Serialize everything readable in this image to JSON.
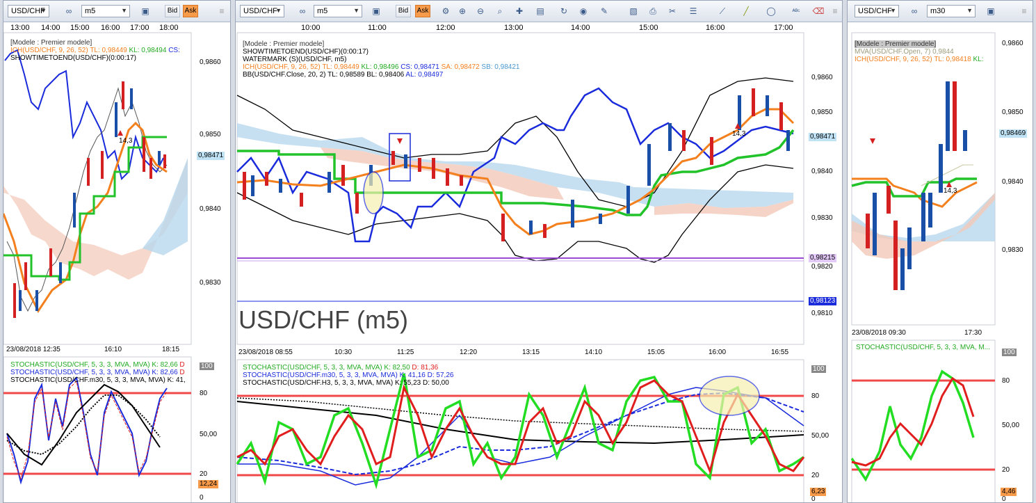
{
  "windows": {
    "left": {
      "symbol": "USD/CHF",
      "timeframe": "m5",
      "bid": "Bid",
      "ask": "Ask",
      "time_labels": [
        "13:00",
        "14:00",
        "15:00",
        "16:00",
        "17:00",
        "18:00"
      ],
      "price_labels": [
        "0,9860",
        "0,9850",
        "0,9840",
        "0,9830"
      ],
      "price_tag": "0,98471",
      "legend": {
        "model": "[Modele : Premier modele]",
        "ich": "ICH(USD/CHF, 9, 26, 52)",
        "ich_tl": "TL: 0,98449",
        "ich_kl": "KL: 0,98494",
        "ich_cs": "CS:",
        "showtime": "SHOWTIMETOEND(USD/CHF)(0:00:17)"
      },
      "date_labels": [
        "23/08/2018 12:35",
        "16:10",
        "18:15"
      ],
      "arrow_label": "14,3",
      "stoch": {
        "l1": "STOCHASTIC(USD/CHF, 5, 3, 3, MVA, MVA)",
        "l1k": "K: 82,66",
        "l1d": "D",
        "l2": "STOCHASTIC(USD/CHF, 5, 3, 3, MVA, MVA)",
        "l2k": "K: 82,66",
        "l2d": "D",
        "l3": "STOCHASTIC(USD/CHF.m30, 5, 3, 3, MVA, MVA)",
        "l3k": "K: 41,",
        "levels": [
          "100",
          "80",
          "50,00",
          "20",
          "0"
        ],
        "tag": "12,24"
      }
    },
    "center": {
      "symbol": "USD/CHF",
      "timeframe": "m5",
      "bid": "Bid",
      "ask": "Ask",
      "time_labels": [
        "10:00",
        "11:00",
        "12:00",
        "13:00",
        "14:00",
        "15:00",
        "16:00",
        "17:00"
      ],
      "price_labels": [
        "0,9860",
        "0,9850",
        "0,9840",
        "0,9830",
        "0,9820",
        "0,9810"
      ],
      "price_tag": "0,98471",
      "tag_purple": "0,98215",
      "tag_blue": "0,98123",
      "watermark": "USD/CHF (m5)",
      "legend": {
        "model": "[Modele : Premier modele]",
        "showtime": "SHOWTIMETOEND(USD/CHF)(0:00:17)",
        "watermark": "WATERMARK (S)(USD/CHF, m5)",
        "ich": "ICH(USD/CHF, 9, 26, 52)",
        "ich_tl": "TL: 0,98449",
        "ich_kl": "KL: 0,98496",
        "ich_cs": "CS: 0,98471",
        "ich_sa": "SA: 0,98472",
        "ich_sb": "SB: 0,98421",
        "bb": "BB(USD/CHF.Close, 20, 2)",
        "bb_tl": "TL: 0,98589",
        "bb_bl": "BL: 0,98406",
        "bb_al": "AL: 0,98497"
      },
      "arrow_label": "14,3",
      "date_labels": [
        "23/08/2018 08:55",
        "10:30",
        "11:25",
        "12:20",
        "13:15",
        "14:10",
        "15:05",
        "16:00",
        "16:55"
      ],
      "stoch": {
        "l1": "STOCHASTIC(USD/CHF, 5, 3, 3, MVA, MVA)",
        "l1k": "K: 82,50",
        "l1d": "D: 81,36",
        "l2": "STOCHASTIC(USD/CHF.m30, 5, 3, 3, MVA, MVA)",
        "l2k": "K: 41,16",
        "l2d": "D: 57,26",
        "l3": "STOCHASTIC(USD/CHF.H3, 5, 3, 3, MVA, MVA)",
        "l3k": "K: 55,23",
        "l3d": "D: 50,00",
        "levels": [
          "100",
          "80",
          "50,00",
          "20",
          "0"
        ],
        "tag": "6,23"
      }
    },
    "right": {
      "symbol": "USD/CHF",
      "timeframe": "m30",
      "price_labels": [
        "0,9860",
        "0,9850",
        "0,9840",
        "0,9830"
      ],
      "price_tag": "0,98469",
      "legend": {
        "model": "[Modele : Premier modele]",
        "mva": "MVA(USD/CHF.Open, 7)",
        "mva_v": "0,9844",
        "ich": "ICH(USD/CHF, 9, 26, 52)",
        "ich_tl": "TL: 0,98418",
        "ich_kl": "KL:"
      },
      "arrow_label": "14,3",
      "date_labels": [
        "23/08/2018 09:30",
        "17:30"
      ],
      "stoch": {
        "l1": "STOCHASTIC(USD/CHF, 5, 3, 3, MVA, M...",
        "levels": [
          "100",
          "80",
          "50,00",
          "20",
          "0"
        ],
        "tag": "4,46"
      }
    }
  },
  "colors": {
    "ask": "#f79a4a",
    "ichimoku_tl": "#f47f1d",
    "ichimoku_kl": "#22c22a",
    "price_line": "#1a2bdb",
    "bb": "#000000",
    "stoch_k": "#22dd22",
    "stoch_d": "#e01e1e",
    "level": "#f04848"
  }
}
